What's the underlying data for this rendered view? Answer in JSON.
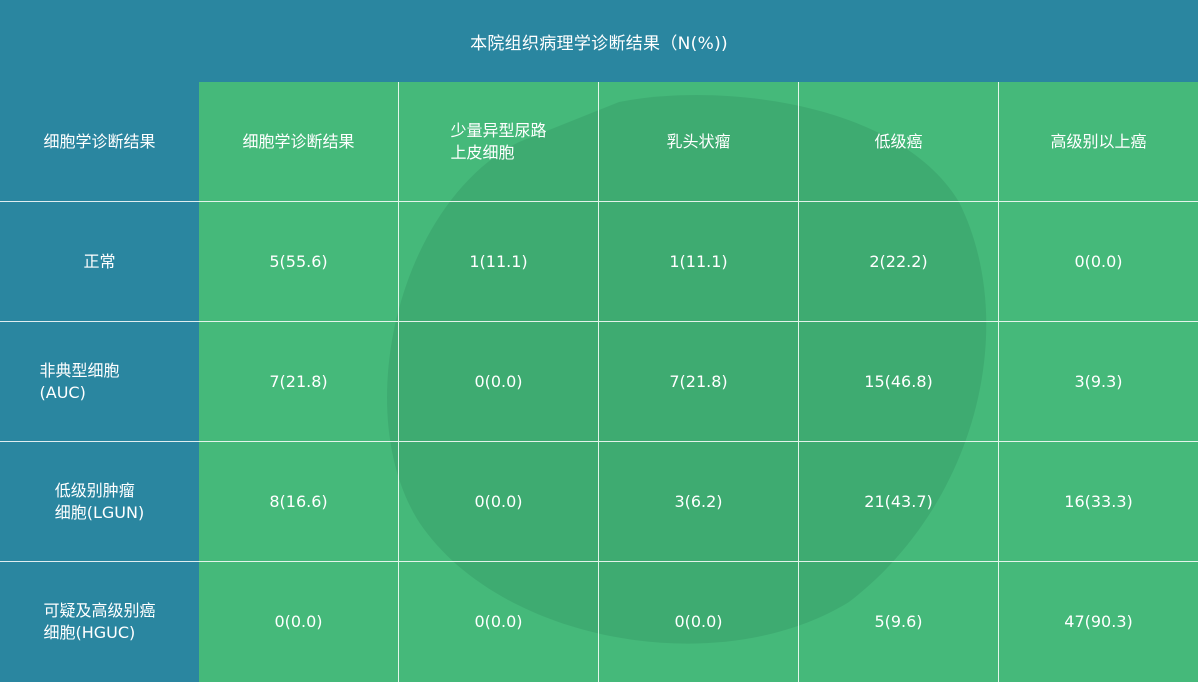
{
  "title": "本院组织病理学诊断结果（N(%))",
  "header_row": [
    "细胞学诊断结果",
    "细胞学诊断结果",
    "少量异型尿路\n上皮细胞",
    "乳头状瘤",
    "低级癌",
    "高级别以上癌"
  ],
  "rows": [
    {
      "label": "正常",
      "cells": [
        "5(55.6)",
        "1(11.1)",
        "1(11.1)",
        "2(22.2)",
        "0(0.0)"
      ]
    },
    {
      "label": "非典型细胞(AUC)",
      "cells": [
        "7(21.8)",
        "0(0.0)",
        "7(21.8)",
        "15(46.8)",
        "3(9.3)"
      ]
    },
    {
      "label": "低级别肿瘤\n细胞(LGUN)",
      "cells": [
        "8(16.6)",
        "0(0.0)",
        "3(6.2)",
        "21(43.7)",
        "16(33.3)"
      ]
    },
    {
      "label": "可疑及高级别癌\n细胞(HGUC)",
      "cells": [
        "0(0.0)",
        "0(0.0)",
        "0(0.0)",
        "5(9.6)",
        "47(90.3)"
      ]
    }
  ],
  "colors": {
    "header_blue": "#2a86a0",
    "table_green": "#45b97a",
    "grid_line": "#ffffff"
  },
  "chart_data": {
    "type": "table",
    "title": "本院组织病理学诊断结果（N(%))",
    "columns": [
      "细胞学诊断结果",
      "少量异型尿路上皮细胞",
      "乳头状瘤",
      "低级癌",
      "高级别以上癌"
    ],
    "row_labels": [
      "正常",
      "非典型细胞(AUC)",
      "低级别肿瘤细胞(LGUN)",
      "可疑及高级别癌细胞(HGUC)"
    ],
    "values": [
      [
        [
          5,
          55.6
        ],
        [
          1,
          11.1
        ],
        [
          1,
          11.1
        ],
        [
          2,
          22.2
        ],
        [
          0,
          0.0
        ]
      ],
      [
        [
          7,
          21.8
        ],
        [
          0,
          0.0
        ],
        [
          7,
          21.8
        ],
        [
          15,
          46.8
        ],
        [
          3,
          9.3
        ]
      ],
      [
        [
          8,
          16.6
        ],
        [
          0,
          0.0
        ],
        [
          3,
          6.2
        ],
        [
          21,
          43.7
        ],
        [
          16,
          33.3
        ]
      ],
      [
        [
          0,
          0.0
        ],
        [
          0,
          0.0
        ],
        [
          0,
          0.0
        ],
        [
          5,
          9.6
        ],
        [
          47,
          90.3
        ]
      ]
    ]
  }
}
